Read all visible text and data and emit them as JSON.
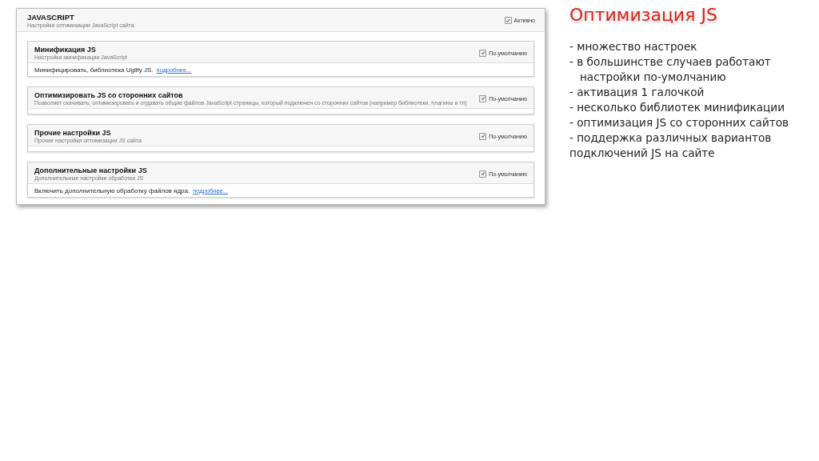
{
  "panel": {
    "title": "JAVASCRIPT",
    "subtitle": "Настройки оптимизации JavaScript сайта",
    "toggle": {
      "label": "Активно",
      "checked": true
    }
  },
  "sections": [
    {
      "title": "Минификация JS",
      "subtitle": "Настройки минификации JavaScript",
      "toggle": {
        "label": "По-умолчанию",
        "checked": true
      },
      "body": "Минифицировать, библиотека Uglify JS.",
      "link": "подробнее..."
    },
    {
      "title": "Оптимизировать JS со сторонних сайтов",
      "subtitle": "Позволяет скачивать, оптимизировать и отдавать общие файлов JavaScript страницы, который подключен со сторонних сайтов (например библиотеки, плагины и тп)",
      "toggle": {
        "label": "По-умолчанию",
        "checked": true
      }
    },
    {
      "title": "Прочие настройки JS",
      "subtitle": "Прочие настройки оптимизации JS сайта",
      "toggle": {
        "label": "По-умолчанию",
        "checked": true
      }
    },
    {
      "title": "Дополнительные настройки JS",
      "subtitle": "Дополнительные настройки обработки JS",
      "toggle": {
        "label": "По-умолчанию",
        "checked": true
      },
      "body": "Включить дополнительную обработку файлов ядра.",
      "link": "подробнее..."
    }
  ],
  "slide": {
    "title": "Оптимизация JS",
    "bullets": [
      "- множество настроек",
      "- в большинстве случаев работают\n   настройки по-умолчанию",
      "- активация 1 галочкой",
      "- несколько библиотек минификации",
      "- оптимизация JS со сторонних сайтов",
      "- поддержка различных вариантов\nподключений JS на сайте"
    ]
  }
}
